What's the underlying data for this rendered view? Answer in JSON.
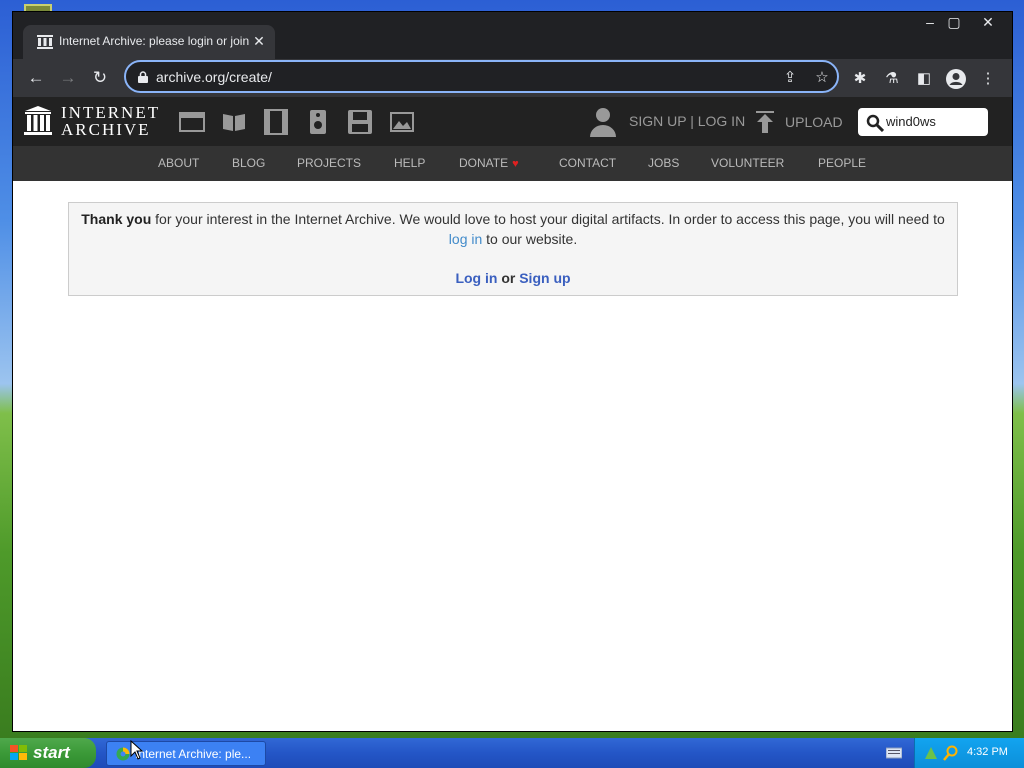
{
  "browser": {
    "tab_title": "Internet Archive: please login or join",
    "url": "archive.org/create/"
  },
  "ia_header": {
    "logo_line1": "INTERNET",
    "logo_line2": "ARCHIVE",
    "signup_login": "SIGN UP | LOG IN",
    "upload": "UPLOAD",
    "search_value": "wind0ws",
    "media_icons": [
      "web-icon",
      "texts-icon",
      "video-icon",
      "audio-icon",
      "software-icon",
      "images-icon"
    ]
  },
  "ia_nav": {
    "items": [
      "ABOUT",
      "BLOG",
      "PROJECTS",
      "HELP",
      "DONATE",
      "CONTACT",
      "JOBS",
      "VOLUNTEER",
      "PEOPLE"
    ]
  },
  "notice": {
    "thank_you": "Thank you",
    "text_part1": " for your interest in the Internet Archive. We would love to host your digital artifacts. In order to access this page, you will need to ",
    "login_link": "log in",
    "text_part2": " to our website.",
    "action_login": "Log in",
    "action_or": " or ",
    "action_signup": "Sign up"
  },
  "taskbar": {
    "start_label": "start",
    "task_label": "Internet Archive: ple...",
    "clock": "4:32 PM"
  },
  "colors": {
    "accent_focus": "#8ab4f8",
    "link": "#428bca",
    "donate_heart": "#e02020"
  }
}
